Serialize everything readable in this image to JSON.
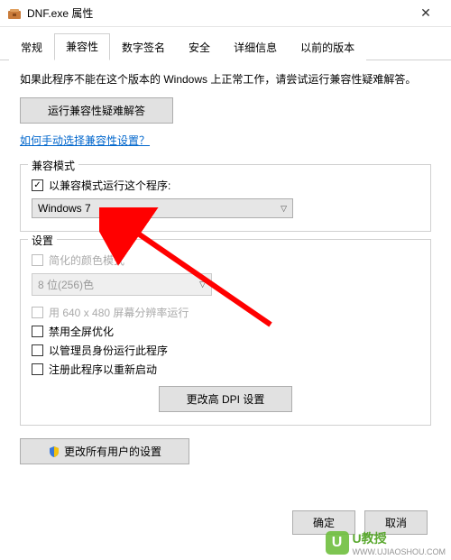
{
  "window": {
    "title": "DNF.exe 属性",
    "close_glyph": "✕"
  },
  "tabs": [
    {
      "label": "常规"
    },
    {
      "label": "兼容性"
    },
    {
      "label": "数字签名"
    },
    {
      "label": "安全"
    },
    {
      "label": "详细信息"
    },
    {
      "label": "以前的版本"
    }
  ],
  "intro": "如果此程序不能在这个版本的 Windows 上正常工作，请尝试运行兼容性疑难解答。",
  "troubleshoot_button": "运行兼容性疑难解答",
  "manual_link": "如何手动选择兼容性设置？",
  "compat_mode": {
    "group_title": "兼容模式",
    "checkbox_label": "以兼容模式运行这个程序:",
    "selected": "Windows 7"
  },
  "settings": {
    "group_title": "设置",
    "reduced_color_label": "简化的颜色模式",
    "color_select": "8 位(256)色",
    "low_res_label": "用 640 x 480 屏幕分辨率运行",
    "disable_fullscreen_label": "禁用全屏优化",
    "run_as_admin_label": "以管理员身份运行此程序",
    "register_restart_label": "注册此程序以重新启动",
    "dpi_button": "更改高 DPI 设置"
  },
  "all_users_button": "更改所有用户的设置",
  "footer": {
    "ok": "确定",
    "cancel": "取消"
  },
  "watermark": {
    "brand": "U教授",
    "url": "WWW.UJIAOSHOU.COM"
  }
}
